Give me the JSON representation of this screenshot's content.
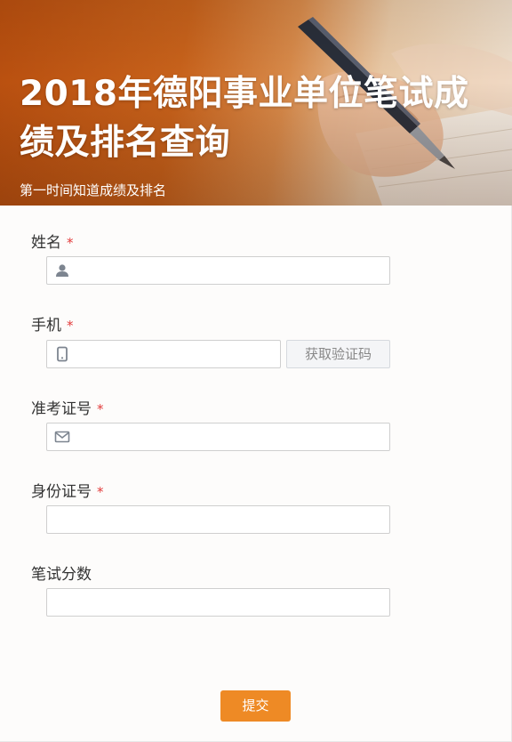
{
  "banner": {
    "title": "2018年德阳事业单位笔试成绩及排名查询",
    "subtitle": "第一时间知道成绩及排名"
  },
  "fields": {
    "name": {
      "label": "姓名",
      "required_mark": "*",
      "icon": "user-icon"
    },
    "phone": {
      "label": "手机",
      "required_mark": "*",
      "icon": "mobile-phone-icon",
      "code_button": "获取验证码"
    },
    "exam_id": {
      "label": "准考证号",
      "required_mark": "*",
      "icon": "mail-icon"
    },
    "id_number": {
      "label": "身份证号",
      "required_mark": "*"
    },
    "score": {
      "label": "笔试分数"
    }
  },
  "submit_label": "提交",
  "colors": {
    "accent": "#ee8a25",
    "required": "#e23b3b",
    "banner_dark": "#b94f0f"
  }
}
